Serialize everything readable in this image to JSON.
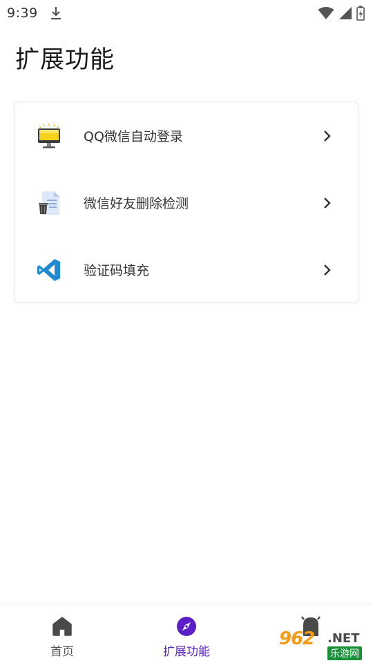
{
  "status_bar": {
    "time": "9:39",
    "icons": [
      "download-icon",
      "wifi-icon",
      "signal-icon",
      "battery-icon"
    ]
  },
  "page": {
    "title": "扩展功能"
  },
  "features": [
    {
      "label": "QQ微信自动登录",
      "icon": "monitor-icon"
    },
    {
      "label": "微信好友删除检测",
      "icon": "document-trash-icon"
    },
    {
      "label": "验证码填充",
      "icon": "vscode-icon"
    }
  ],
  "bottom_nav": {
    "items": [
      {
        "label": "首页",
        "icon": "home-icon",
        "active": false
      },
      {
        "label": "扩展功能",
        "icon": "compass-icon",
        "active": true
      },
      {
        "label": "",
        "icon": "ghost-icon",
        "active": false
      }
    ],
    "active_color": "#5b1fc8"
  },
  "watermark": {
    "brand": "962",
    "suffix": ".NET",
    "sub": "乐游网"
  }
}
